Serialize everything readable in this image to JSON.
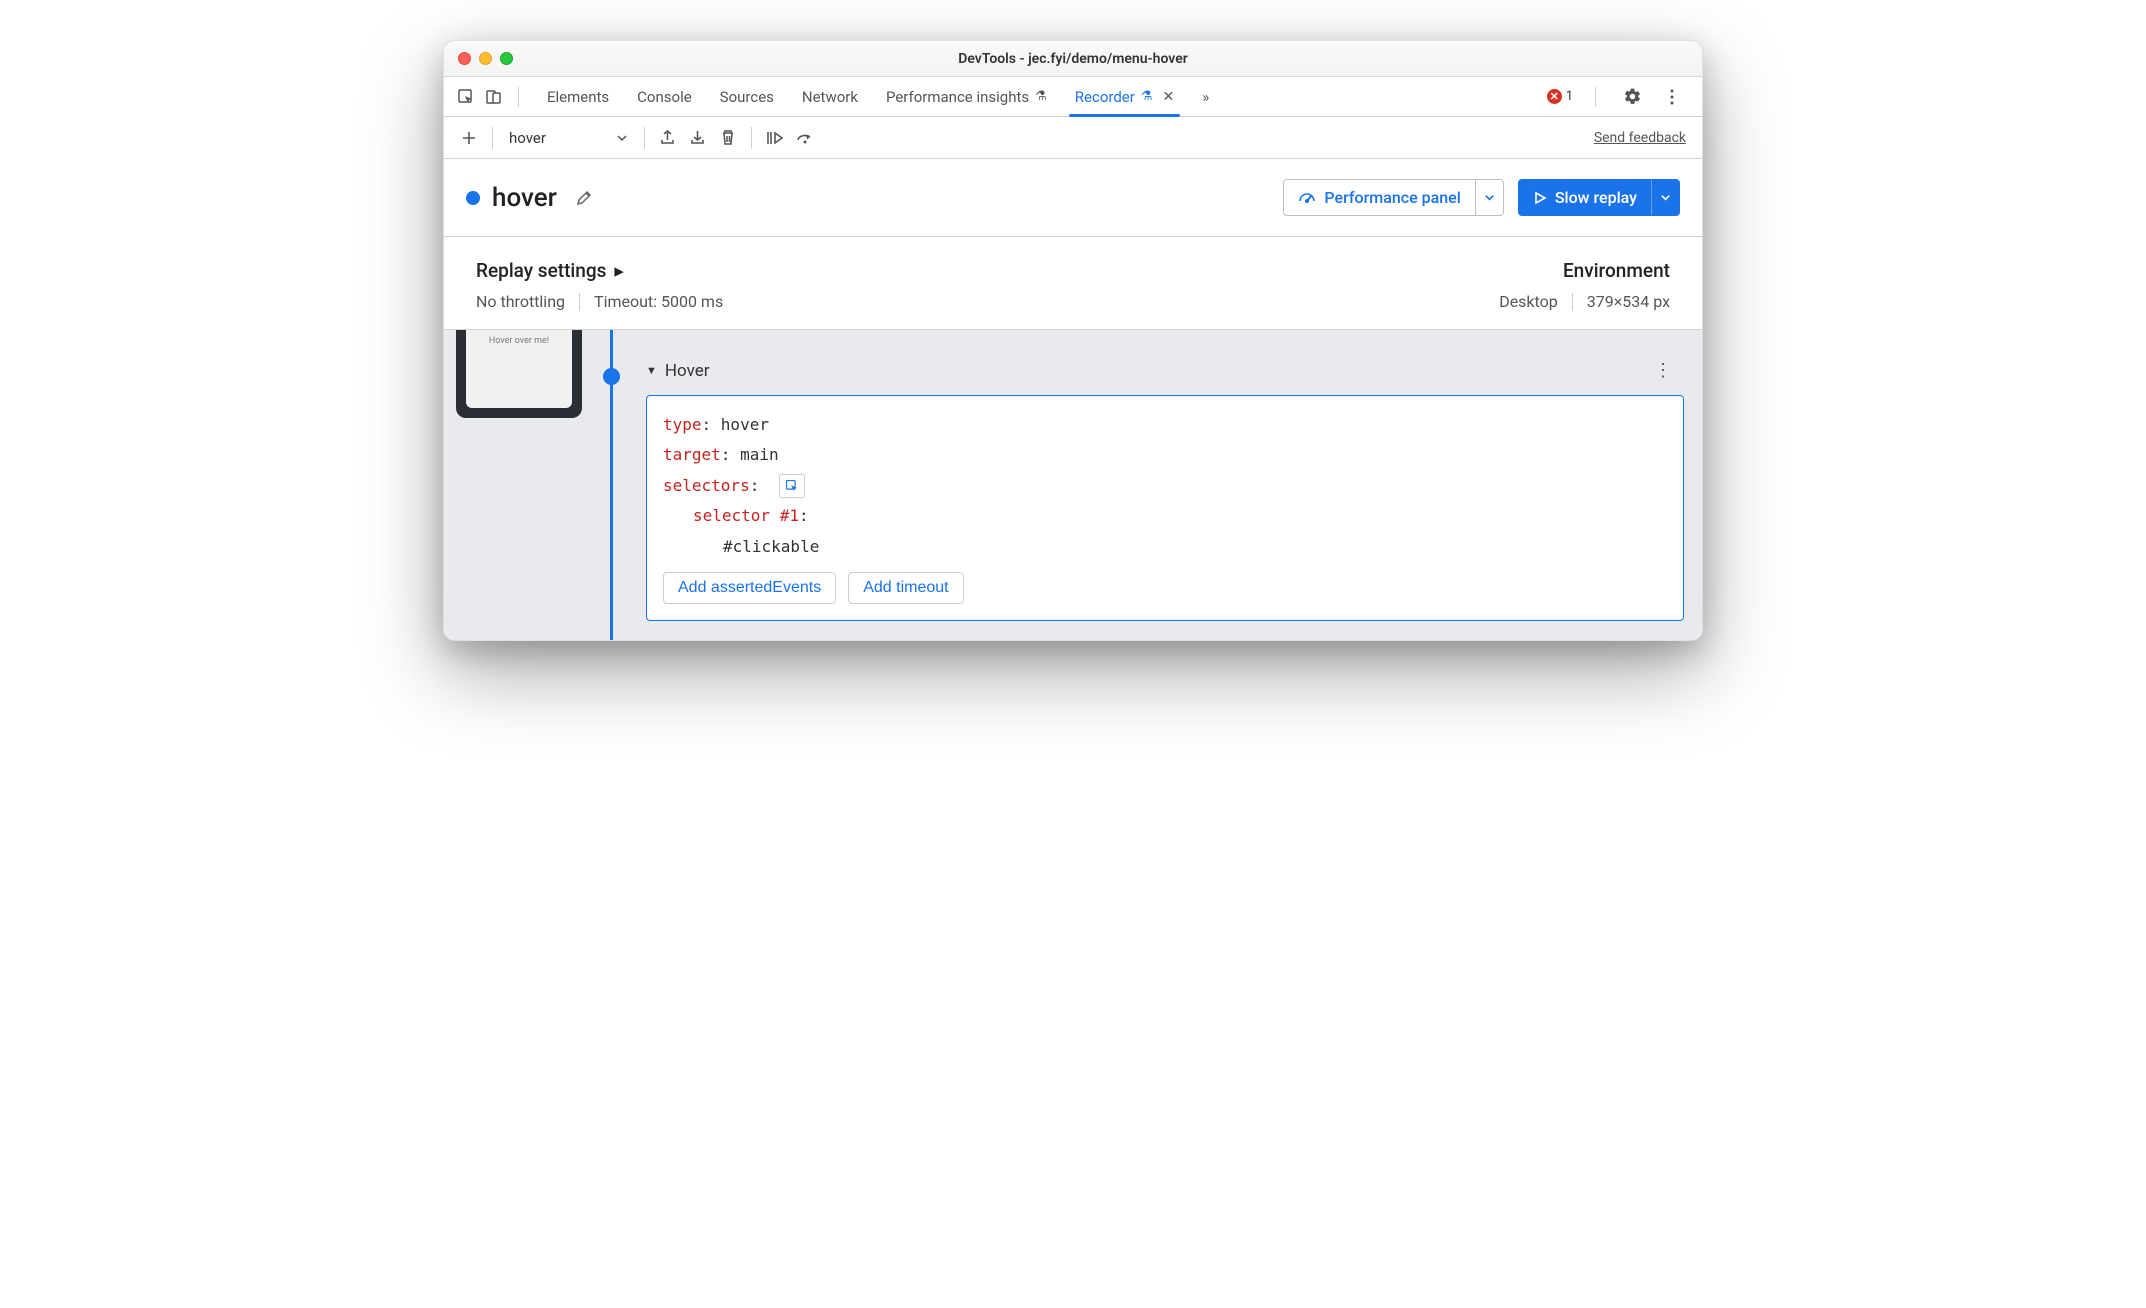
{
  "window": {
    "title": "DevTools - jec.fyi/demo/menu-hover"
  },
  "tabs": {
    "items": [
      "Elements",
      "Console",
      "Sources",
      "Network",
      "Performance insights",
      "Recorder"
    ],
    "active": "Recorder"
  },
  "errors": {
    "count": "1"
  },
  "toolbar": {
    "recording_dropdown": "hover",
    "send_feedback": "Send feedback"
  },
  "recording": {
    "name": "hover",
    "perf_button": "Performance panel",
    "replay_button": "Slow replay"
  },
  "settings": {
    "replay_title": "Replay settings",
    "throttling": "No throttling",
    "timeout": "Timeout: 5000 ms",
    "env_title": "Environment",
    "device": "Desktop",
    "dimensions": "379×534 px"
  },
  "thumbnail": {
    "label": "Hover over me!"
  },
  "step": {
    "title": "Hover",
    "labels": {
      "type": "type",
      "target": "target",
      "selectors": "selectors",
      "selector_n": "selector #1"
    },
    "type_value": "hover",
    "target_value": "main",
    "selector1_value": "#clickable",
    "add_asserted": "Add assertedEvents",
    "add_timeout": "Add timeout"
  }
}
